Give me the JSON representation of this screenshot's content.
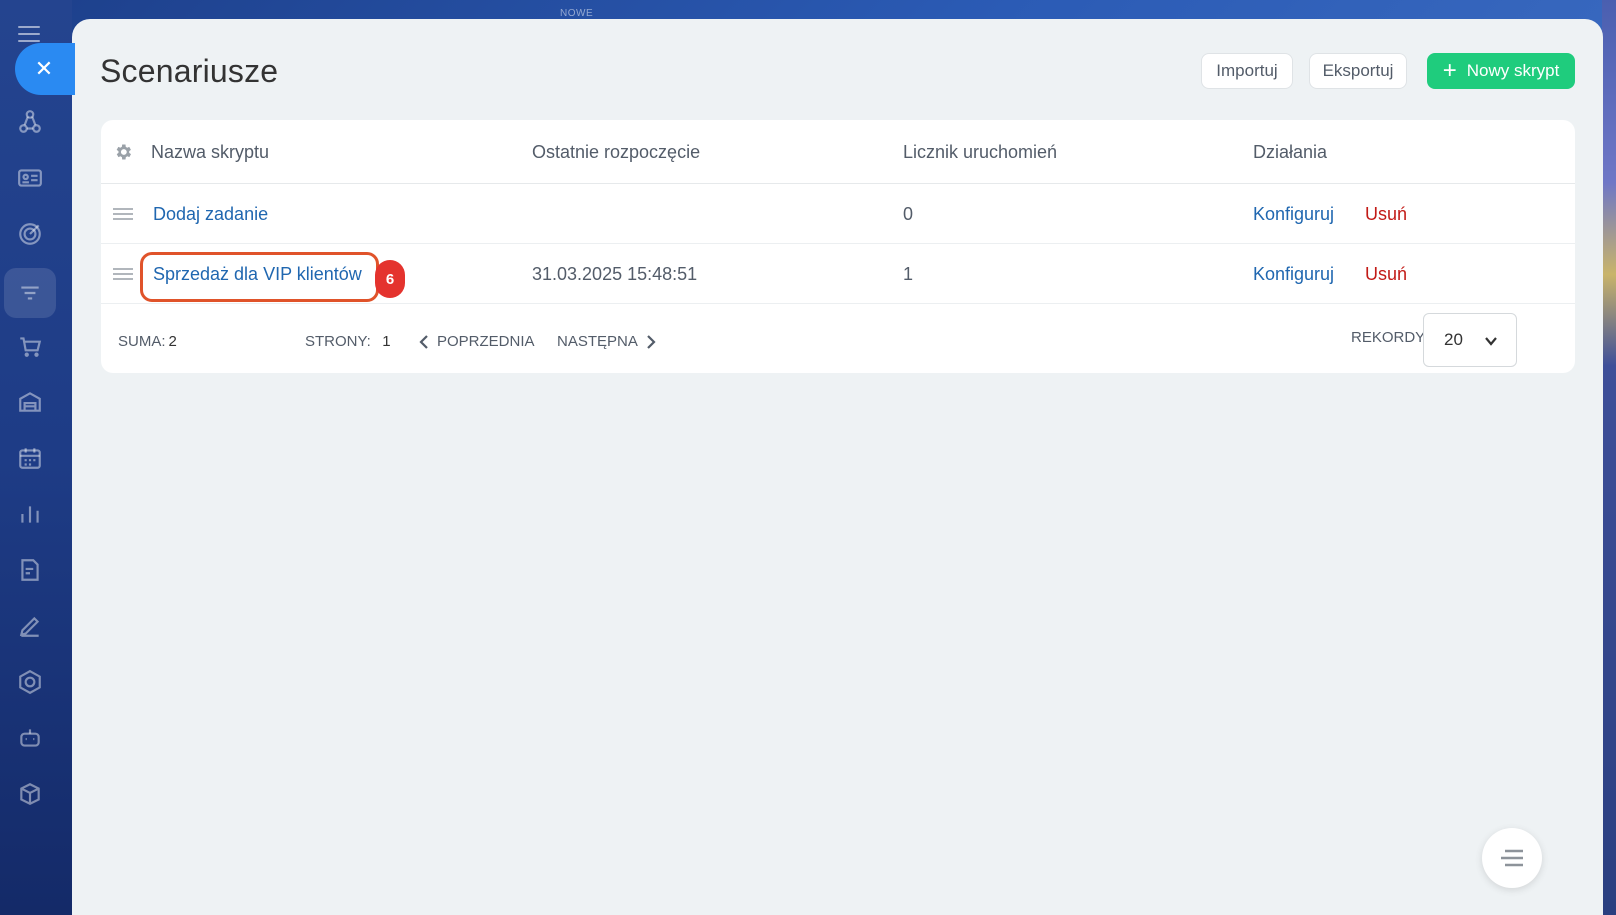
{
  "background_hint": "NOWE",
  "panel": {
    "title": "Scenariusze",
    "buttons": {
      "import": "Importuj",
      "export": "Eksportuj",
      "new_plus": "+",
      "new": "Nowy skrypt"
    }
  },
  "table": {
    "columns": [
      "Nazwa skryptu",
      "Ostatnie rozpoczęcie",
      "Licznik uruchomień",
      "Działania"
    ],
    "rows": [
      {
        "name": "Dodaj zadanie",
        "last_start": "",
        "count": "0",
        "configure": "Konfiguruj",
        "delete": "Usuń"
      },
      {
        "name": "Sprzedaż dla VIP klientów",
        "last_start": "31.03.2025 15:48:51",
        "count": "1",
        "configure": "Konfiguruj",
        "delete": "Usuń",
        "badge": "6"
      }
    ]
  },
  "footer": {
    "sum_label": "SUMA:",
    "sum_value": "2",
    "pages_label": "STRONY:",
    "pages_value": "1",
    "prev": "POPRZEDNIA",
    "next": "NASTĘPNA",
    "records_label": "REKORDY:",
    "records_value": "20"
  },
  "colors": {
    "accent_green": "#1fcc7d",
    "link_blue": "#2067b0",
    "delete_red": "#c21b17",
    "highlight": "#e0532a"
  }
}
